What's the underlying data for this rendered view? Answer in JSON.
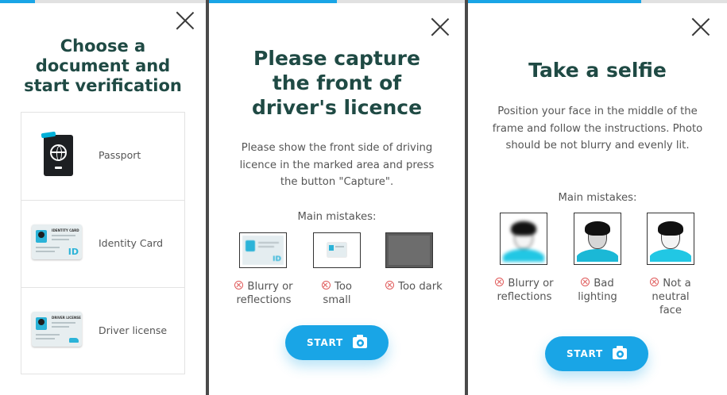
{
  "panels": [
    {
      "title": "Choose a document and start verification",
      "documents": [
        {
          "label": "Passport",
          "icon": "passport-icon"
        },
        {
          "label": "Identity Card",
          "icon": "id-card-icon"
        },
        {
          "label": "Driver license",
          "icon": "driver-license-icon"
        }
      ],
      "id_card_header": "IDENTITY CARD",
      "id_card_mark": "ID",
      "driver_card_header": "DRIVER LICENSE"
    },
    {
      "title": "Please capture the front of driver's licence",
      "description": "Please show the front side of driving licence in the marked area and press the button \"Capture\".",
      "mistakes_label": "Main mistakes:",
      "mistakes": [
        {
          "label": "Blurry or reflections"
        },
        {
          "label": "Too small"
        },
        {
          "label": "Too dark"
        }
      ],
      "start_label": "START"
    },
    {
      "title": "Take a selfie",
      "description": "Position your face in the middle of the frame and follow the instructions. Photo should be not blurry and evenly lit.",
      "mistakes_label": "Main mistakes:",
      "mistakes": [
        {
          "label": "Blurry or reflections"
        },
        {
          "label": "Bad lighting"
        },
        {
          "label": "Not a neutral face"
        }
      ],
      "start_label": "START"
    }
  ],
  "progress": [
    0.17,
    0.5,
    0.67
  ],
  "colors": {
    "accent": "#19a5e6",
    "title": "#1f4a44",
    "error": "#e05b5b",
    "progress_track": "#e1e1e1"
  }
}
